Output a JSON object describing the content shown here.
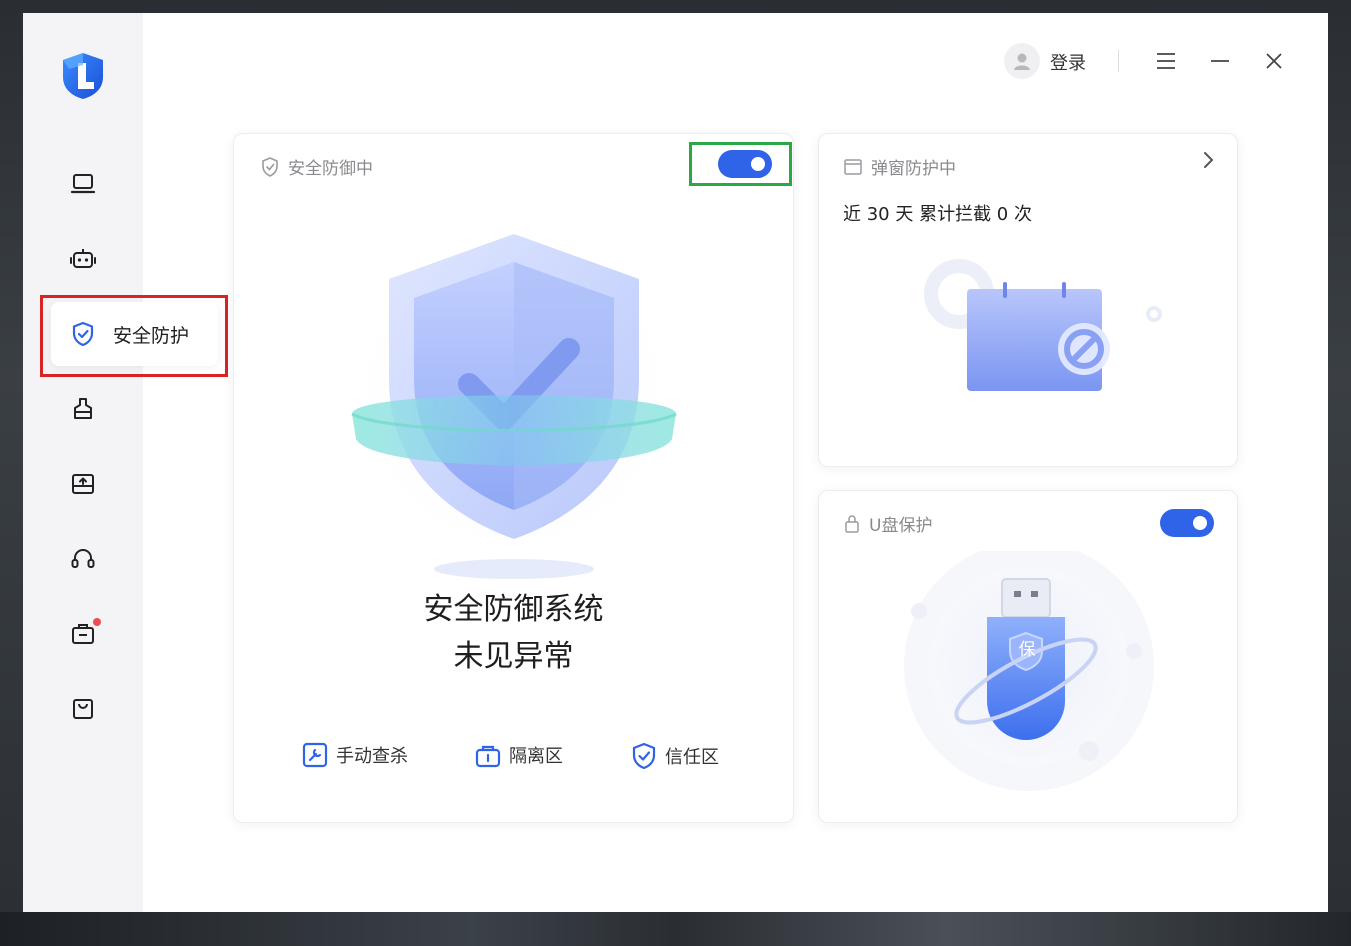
{
  "sidebar": {
    "items": [
      {
        "icon": "laptop-icon"
      },
      {
        "icon": "robot-icon"
      },
      {
        "icon": "shield-check-icon",
        "label": "安全防护",
        "active": true
      },
      {
        "icon": "cleanup-icon"
      },
      {
        "icon": "upload-box-icon"
      },
      {
        "icon": "headset-icon"
      },
      {
        "icon": "toolbox-icon",
        "badge": true
      },
      {
        "icon": "store-bag-icon"
      }
    ]
  },
  "header": {
    "login_label": "登录"
  },
  "defense_card": {
    "title": "安全防御中",
    "toggle_on": true,
    "status_line1": "安全防御系统",
    "status_line2": "未见异常",
    "actions": [
      {
        "label": "手动查杀",
        "icon": "wrench-icon"
      },
      {
        "label": "隔离区",
        "icon": "quarantine-icon"
      },
      {
        "label": "信任区",
        "icon": "trust-shield-icon"
      }
    ]
  },
  "popup_card": {
    "title": "弹窗防护中",
    "stat_text": "近 30 天 累计拦截 0 次"
  },
  "usb_card": {
    "title": "U盘保护",
    "toggle_on": true,
    "badge_text": "保"
  },
  "colors": {
    "accent": "#2f63e8",
    "annotation_red": "#d92424",
    "annotation_green": "#2aa845"
  }
}
